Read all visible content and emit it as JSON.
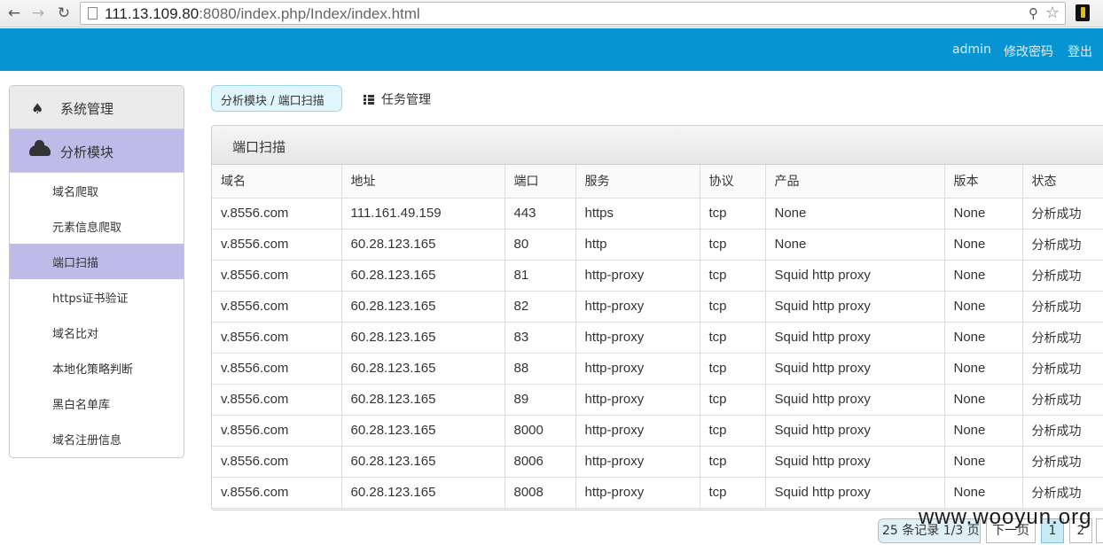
{
  "browser": {
    "url_host": "111.13.109.80",
    "url_rest": ":8080/index.php/Index/index.html"
  },
  "topbar": {
    "user": "admin",
    "change_password": "修改密码",
    "logout": "登出"
  },
  "sidebar": {
    "section_system": "系统管理",
    "section_analysis": "分析模块",
    "items": [
      {
        "label": "域名爬取"
      },
      {
        "label": "元素信息爬取"
      },
      {
        "label": "端口扫描"
      },
      {
        "label": "https证书验证"
      },
      {
        "label": "域名比对"
      },
      {
        "label": "本地化策略判断"
      },
      {
        "label": "黑白名单库"
      },
      {
        "label": "域名注册信息"
      }
    ]
  },
  "breadcrumb": "分析模块 / 端口扫描",
  "task_tab": "任务管理",
  "panel_title": "端口扫描",
  "table": {
    "columns": [
      "域名",
      "地址",
      "端口",
      "服务",
      "协议",
      "产品",
      "版本",
      "状态"
    ],
    "rows": [
      [
        "v.8556.com",
        "111.161.49.159",
        "443",
        "https",
        "tcp",
        "None",
        "None",
        "分析成功"
      ],
      [
        "v.8556.com",
        "60.28.123.165",
        "80",
        "http",
        "tcp",
        "None",
        "None",
        "分析成功"
      ],
      [
        "v.8556.com",
        "60.28.123.165",
        "81",
        "http-proxy",
        "tcp",
        "Squid http proxy",
        "None",
        "分析成功"
      ],
      [
        "v.8556.com",
        "60.28.123.165",
        "82",
        "http-proxy",
        "tcp",
        "Squid http proxy",
        "None",
        "分析成功"
      ],
      [
        "v.8556.com",
        "60.28.123.165",
        "83",
        "http-proxy",
        "tcp",
        "Squid http proxy",
        "None",
        "分析成功"
      ],
      [
        "v.8556.com",
        "60.28.123.165",
        "88",
        "http-proxy",
        "tcp",
        "Squid http proxy",
        "None",
        "分析成功"
      ],
      [
        "v.8556.com",
        "60.28.123.165",
        "89",
        "http-proxy",
        "tcp",
        "Squid http proxy",
        "None",
        "分析成功"
      ],
      [
        "v.8556.com",
        "60.28.123.165",
        "8000",
        "http-proxy",
        "tcp",
        "Squid http proxy",
        "None",
        "分析成功"
      ],
      [
        "v.8556.com",
        "60.28.123.165",
        "8006",
        "http-proxy",
        "tcp",
        "Squid http proxy",
        "None",
        "分析成功"
      ],
      [
        "v.8556.com",
        "60.28.123.165",
        "8008",
        "http-proxy",
        "tcp",
        "Squid http proxy",
        "None",
        "分析成功"
      ]
    ]
  },
  "pagination": {
    "info": "25 条记录 1/3 页",
    "next": "下一页",
    "page1": "1",
    "page2": "2"
  },
  "watermark": "www.wooyun.org"
}
